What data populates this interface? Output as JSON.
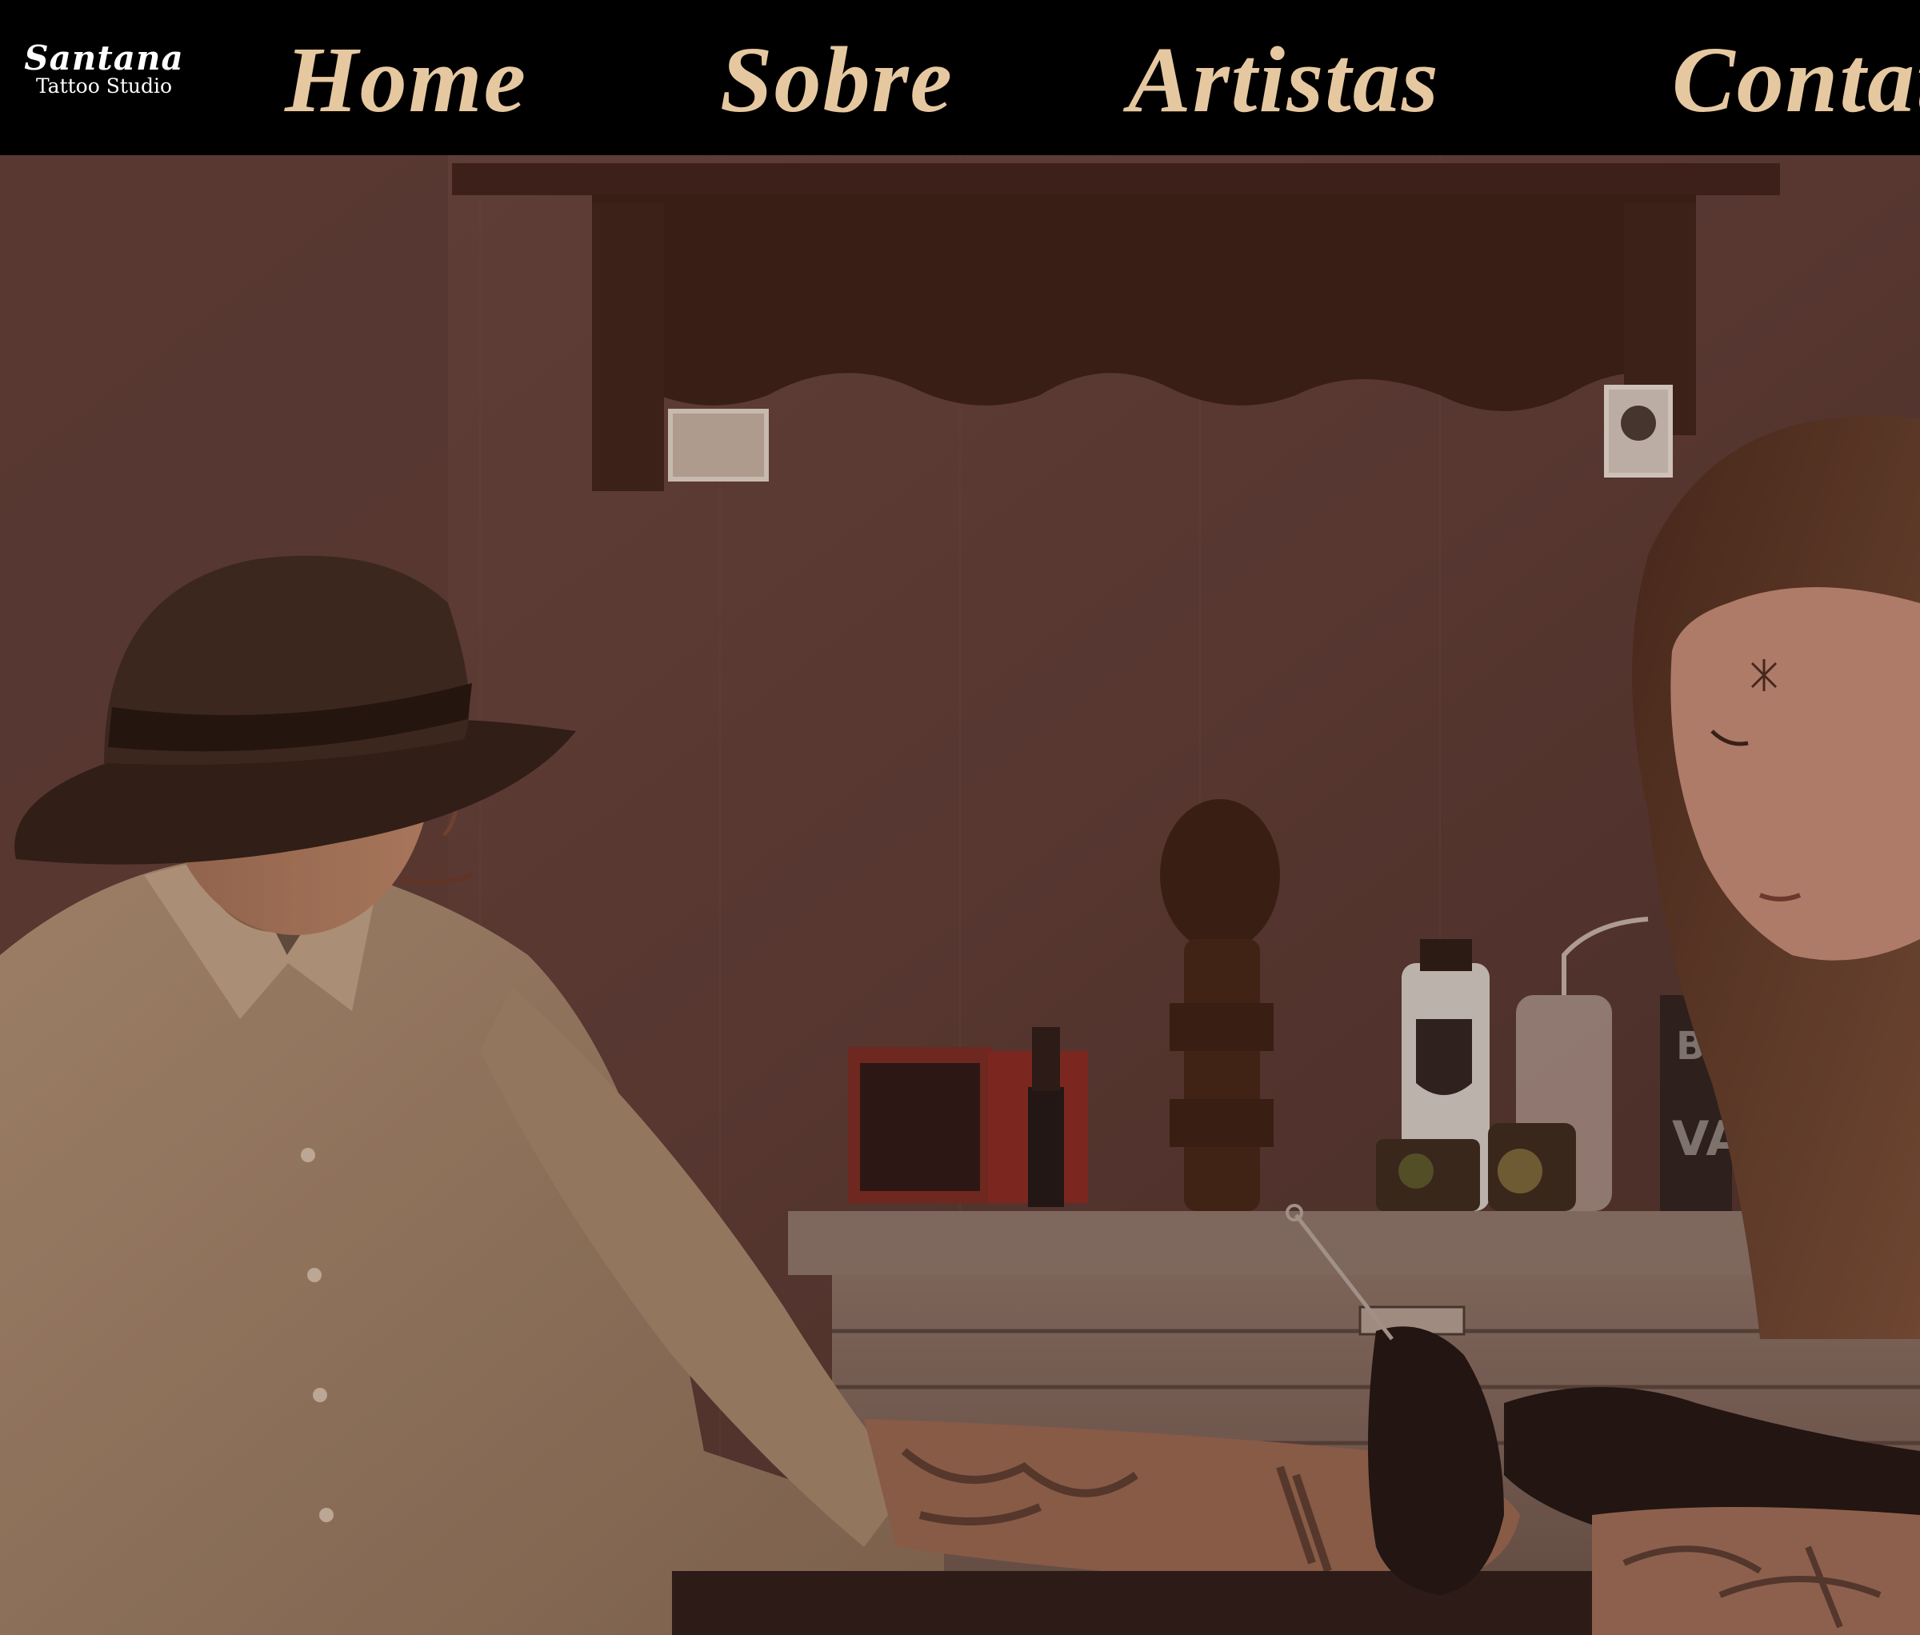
{
  "brand": {
    "name": "Santana",
    "subtitle": "Tattoo Studio"
  },
  "nav": {
    "items": [
      {
        "label": "Home"
      },
      {
        "label": "Sobre"
      },
      {
        "label": "Artistas"
      },
      {
        "label": "Contato"
      }
    ]
  },
  "hero": {
    "image_alt_icon": "tattoo-session-photo"
  },
  "colors": {
    "nav_background": "#000000",
    "nav_text": "#e6c8a0",
    "logo_text": "#ffffff",
    "hero_tint": "#5a3a33"
  }
}
